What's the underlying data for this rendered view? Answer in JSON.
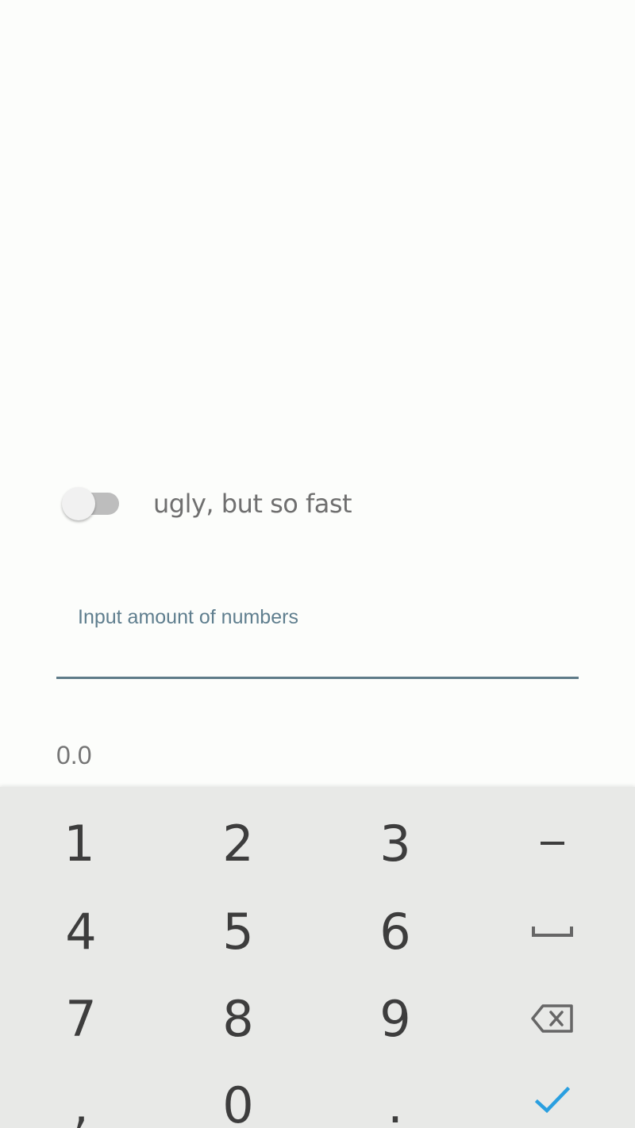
{
  "toggle": {
    "label": "ugly, but so fast",
    "checked": false
  },
  "input": {
    "label": "Input amount of numbers",
    "value": ""
  },
  "result": {
    "value": "0.0"
  },
  "keyboard": {
    "rows": [
      [
        "1",
        "2",
        "3"
      ],
      [
        "4",
        "5",
        "6"
      ],
      [
        "7",
        "8",
        "9"
      ],
      [
        ",",
        "0",
        "."
      ]
    ],
    "icons": [
      "minus-icon",
      "space-icon",
      "backspace-icon",
      "checkmark-icon"
    ],
    "accent_color": "#2a9fe0"
  }
}
